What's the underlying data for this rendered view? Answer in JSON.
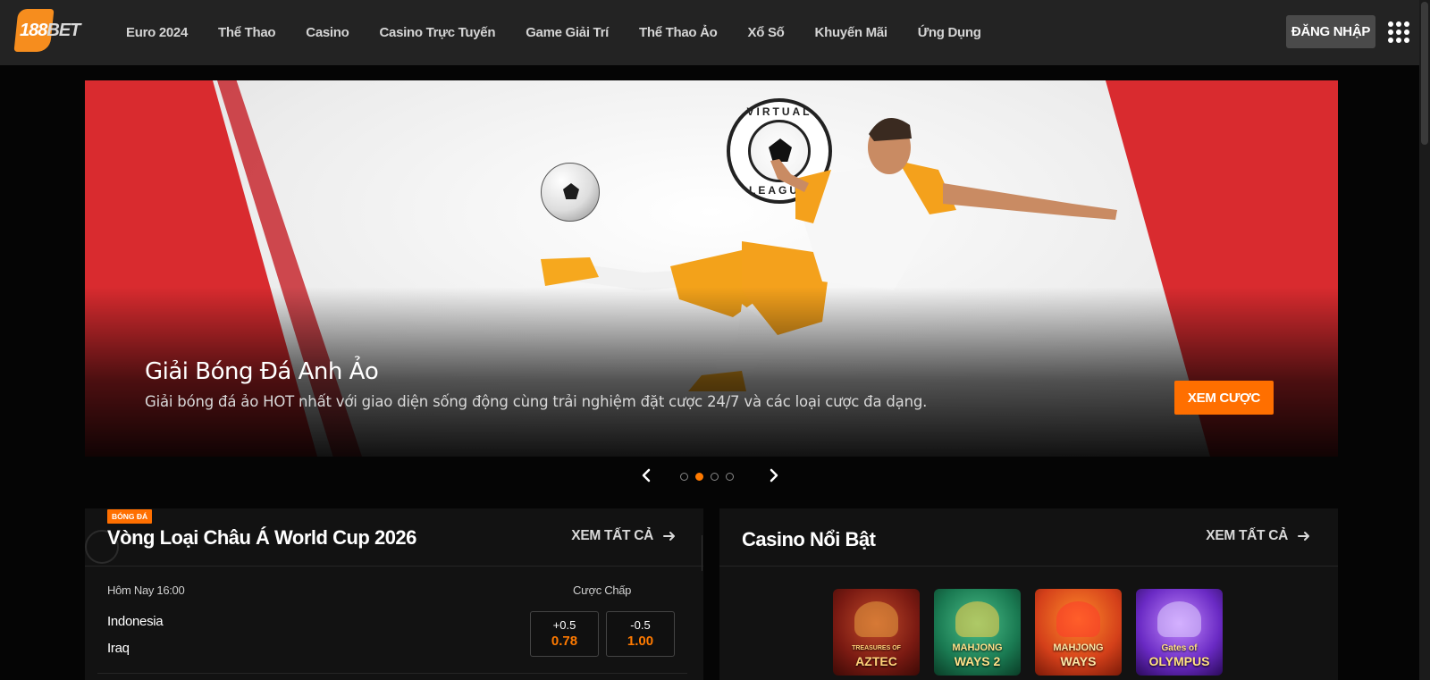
{
  "brand": {
    "logo_num": "188",
    "logo_word": "BET"
  },
  "nav": {
    "items": [
      {
        "label": "Euro 2024"
      },
      {
        "label": "Thể Thao"
      },
      {
        "label": "Casino"
      },
      {
        "label": "Casino Trực Tuyến"
      },
      {
        "label": "Game Giải Trí"
      },
      {
        "label": "Thể Thao Ảo"
      },
      {
        "label": "Xổ Số"
      },
      {
        "label": "Khuyến Mãi"
      },
      {
        "label": "Ứng Dụng"
      }
    ],
    "login_label": "ĐĂNG NHẬP",
    "apps_icon": "grid-dots-icon"
  },
  "banner": {
    "badge_top": "VIRTUAL",
    "badge_bottom": "LEAGUE",
    "title": "Giải Bóng Đá Anh Ảo",
    "description": "Giải bóng đá ảo HOT nhất với giao diện sống động cùng trải nghiệm đặt cược 24/7 và các loại cược đa dạng.",
    "cta_label": "XEM CƯỢC",
    "slides_total": 4,
    "active_slide": 2
  },
  "sports_panel": {
    "tag": "BÓNG ĐÁ",
    "title": "Vòng Loại Châu Á World Cup 2026",
    "see_all": "XEM TẤT CẢ",
    "match": {
      "time": "Hôm Nay 16:00",
      "market_label": "Cược Chấp",
      "home": "Indonesia",
      "away": "Iraq",
      "odds": [
        {
          "line": "+0.5",
          "price": "0.78"
        },
        {
          "line": "-0.5",
          "price": "1.00"
        }
      ]
    }
  },
  "casino_panel": {
    "title": "Casino Nổi Bật",
    "see_all": "XEM TẤT CẢ",
    "games": [
      {
        "name_top": "TREASURES OF",
        "name_main": "AZTEC"
      },
      {
        "name_top": "MAHJONG",
        "name_main": "WAYS 2"
      },
      {
        "name_top": "MAHJONG",
        "name_main": "WAYS"
      },
      {
        "name_top": "Gates of",
        "name_main": "OLYMPUS"
      }
    ]
  },
  "colors": {
    "accent": "#ff6f00",
    "header_bg": "#232323",
    "page_bg": "#050505",
    "banner_red": "#d92b2f"
  }
}
